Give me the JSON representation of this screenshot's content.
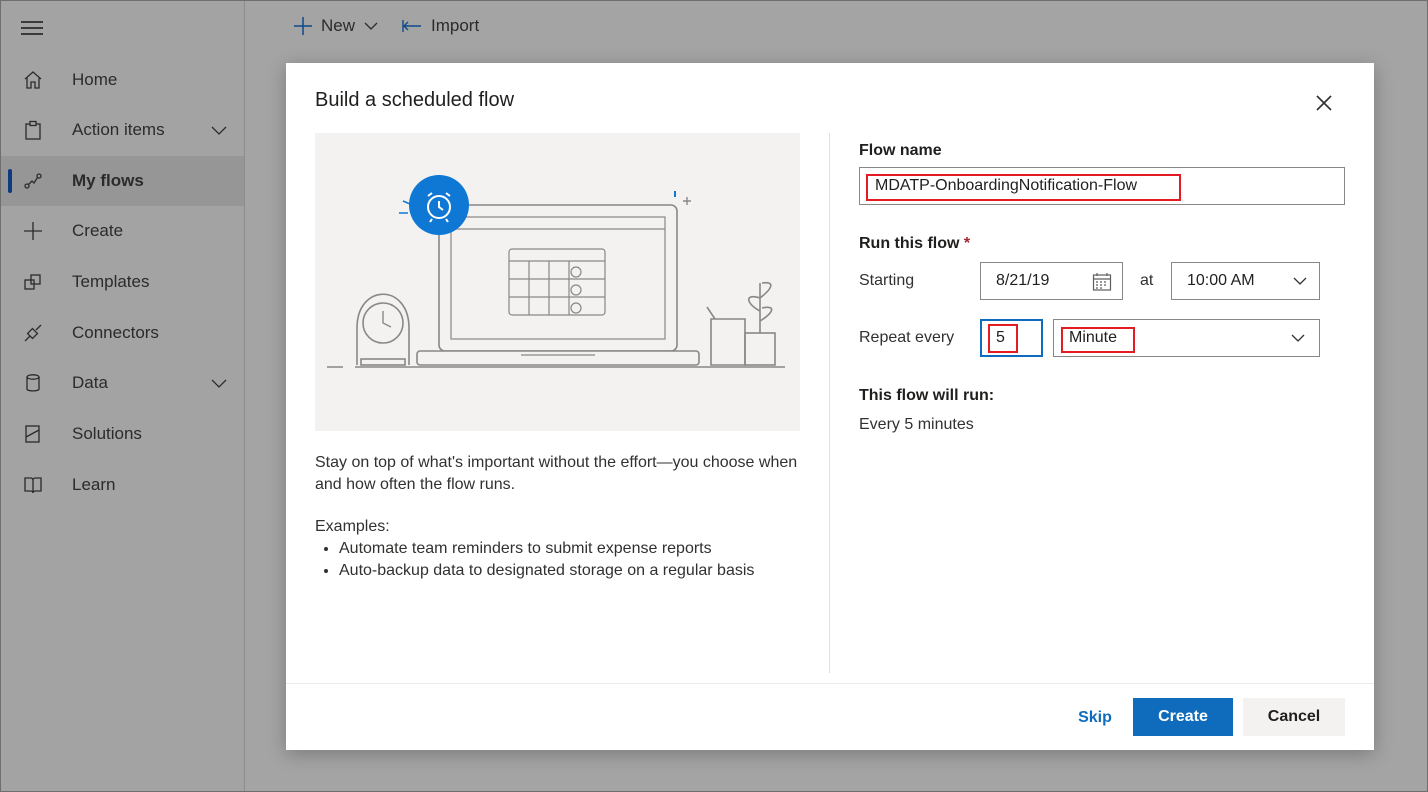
{
  "sidebar": {
    "items": [
      {
        "label": "Home",
        "icon": "home-icon"
      },
      {
        "label": "Action items",
        "icon": "clipboard-icon"
      },
      {
        "label": "My flows",
        "icon": "flow-icon"
      },
      {
        "label": "Create",
        "icon": "plus-icon"
      },
      {
        "label": "Templates",
        "icon": "templates-icon"
      },
      {
        "label": "Connectors",
        "icon": "connector-icon"
      },
      {
        "label": "Data",
        "icon": "database-icon"
      },
      {
        "label": "Solutions",
        "icon": "solutions-icon"
      },
      {
        "label": "Learn",
        "icon": "book-icon"
      }
    ]
  },
  "commandbar": {
    "new_label": "New",
    "import_label": "Import"
  },
  "dialog": {
    "title": "Build a scheduled flow",
    "description": "Stay on top of what's important without the effort—you choose when and how often the flow runs.",
    "examples_heading": "Examples:",
    "examples": [
      "Automate team reminders to submit expense reports",
      "Auto-backup data to designated storage on a regular basis"
    ],
    "flow_name_label": "Flow name",
    "flow_name_value": "MDATP-OnboardingNotification-Flow",
    "run_label": "Run this flow",
    "required_mark": "*",
    "starting_label": "Starting",
    "start_date": "8/21/19",
    "at_label": "at",
    "start_time": "10:00 AM",
    "repeat_label": "Repeat every",
    "repeat_interval": "5",
    "repeat_unit": "Minute",
    "summary_label": "This flow will run:",
    "summary_value": "Every 5 minutes",
    "skip_label": "Skip",
    "create_label": "Create",
    "cancel_label": "Cancel"
  },
  "colors": {
    "primary": "#0f6cbd",
    "highlight": "#e31b23",
    "illustration_accent": "#0f78d4"
  }
}
